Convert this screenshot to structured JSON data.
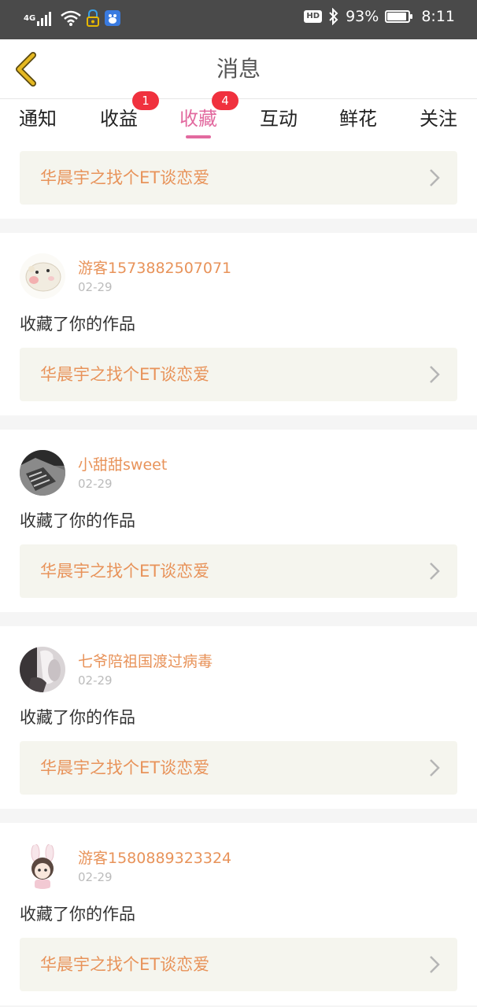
{
  "status_bar": {
    "network": "4G",
    "battery_percent": "93%",
    "battery_level": 0.93,
    "time": "8:11",
    "hd_label": "HD"
  },
  "header": {
    "title": "消息",
    "back_icon": "chevron-left-icon",
    "accent_color": "#e5b821"
  },
  "tabs": [
    {
      "label": "通知",
      "badge": ""
    },
    {
      "label": "收益",
      "badge": "1"
    },
    {
      "label": "收藏",
      "badge": "4",
      "active": true
    },
    {
      "label": "互动",
      "badge": ""
    },
    {
      "label": "鲜花",
      "badge": ""
    },
    {
      "label": "关注",
      "badge": ""
    }
  ],
  "colors": {
    "active_tab": "#e26a9f",
    "badge": "#f0313e",
    "username": "#e8935a",
    "work_title": "#e8935a"
  },
  "first_card": {
    "work_title": "华晨宇之找个ET谈恋爱"
  },
  "messages": [
    {
      "username": "游客1573882507071",
      "date": "02-29",
      "action": "收藏了你的作品",
      "work_title": "华晨宇之找个ET谈恋爱",
      "avatar": "hamster-avatar"
    },
    {
      "username": "小甜甜sweet",
      "date": "02-29",
      "action": "收藏了你的作品",
      "work_title": "华晨宇之找个ET谈恋爱",
      "avatar": "photo-avatar"
    },
    {
      "username": "七爷陪祖国渡过病毒",
      "date": "02-29",
      "action": "收藏了你的作品",
      "work_title": "华晨宇之找个ET谈恋爱",
      "avatar": "photo-avatar"
    },
    {
      "username": "游客1580889323324",
      "date": "02-29",
      "action": "收藏了你的作品",
      "work_title": "华晨宇之找个ET谈恋爱",
      "avatar": "bunny-girl-avatar"
    }
  ]
}
